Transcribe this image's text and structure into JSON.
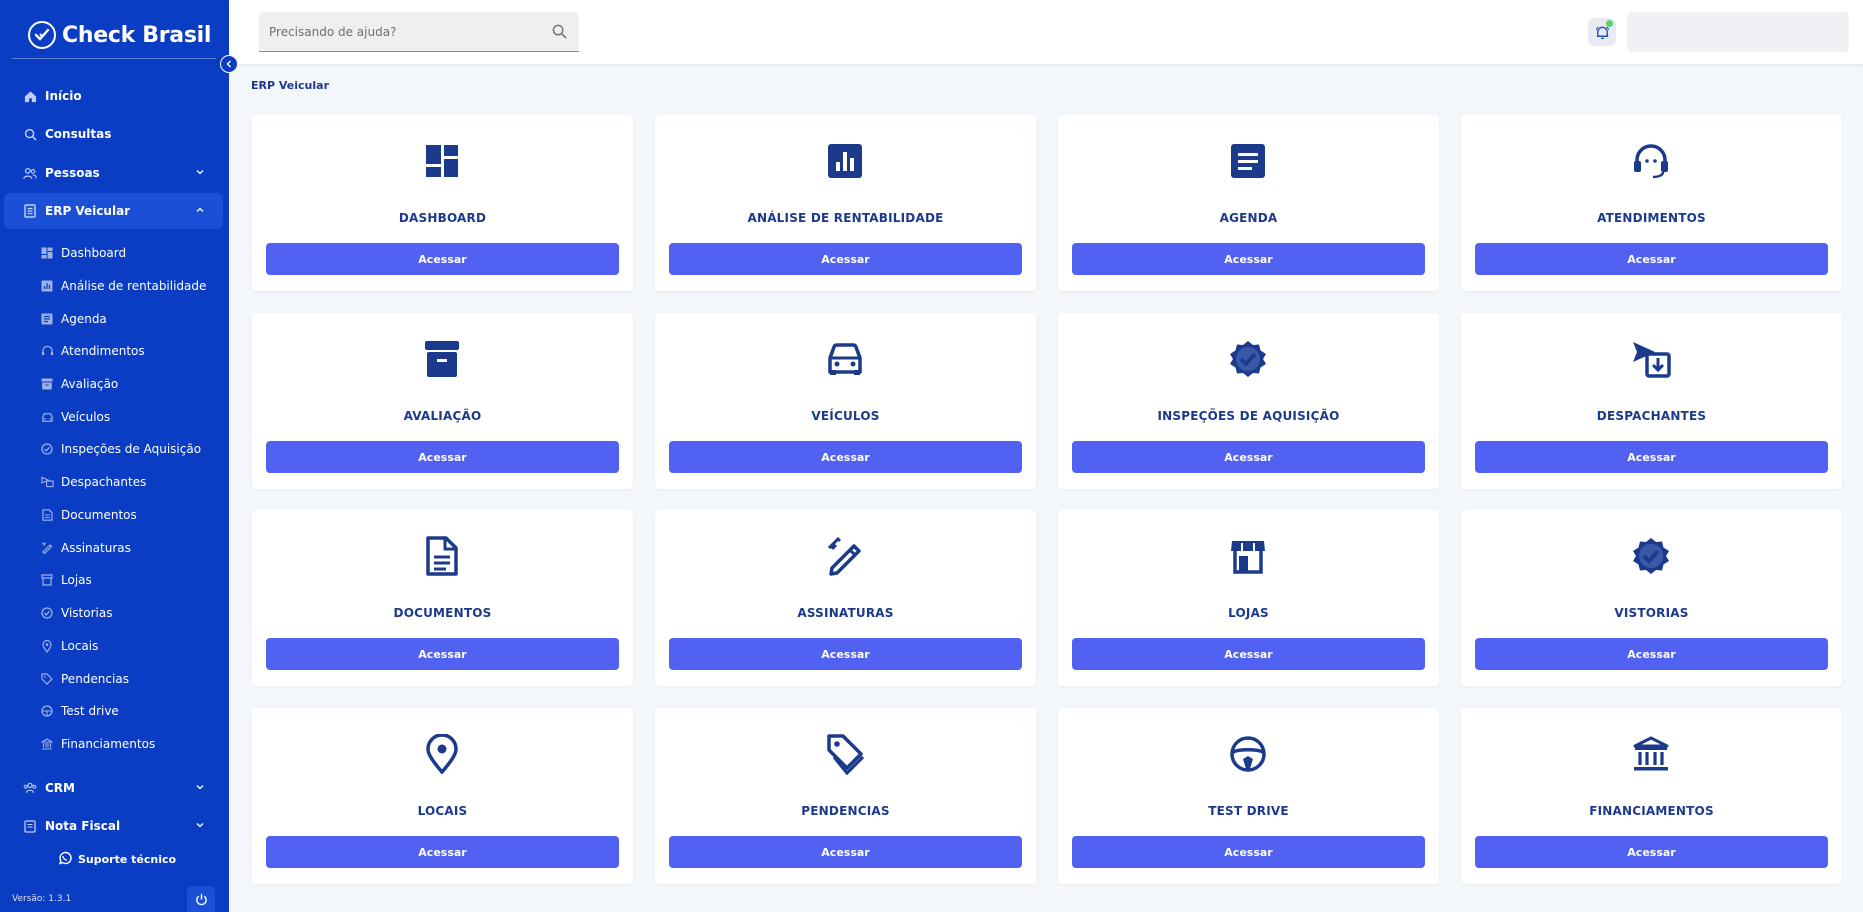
{
  "brand": {
    "name": "Check Brasil"
  },
  "sidebar": {
    "items": [
      {
        "label": "Início",
        "icon": "home-icon"
      },
      {
        "label": "Consultas",
        "icon": "search-icon"
      },
      {
        "label": "Pessoas",
        "icon": "people-icon"
      },
      {
        "label": "ERP Veicular",
        "icon": "erp-icon"
      },
      {
        "label": "CRM",
        "icon": "crm-icon"
      },
      {
        "label": "Nota Fiscal",
        "icon": "invoice-icon"
      }
    ],
    "sub_items": [
      "Dashboard",
      "Análise de rentabilidade",
      "Agenda",
      "Atendimentos",
      "Avaliação",
      "Veículos",
      "Inspeções de Aquisição",
      "Despachantes",
      "Documentos",
      "Assinaturas",
      "Lojas",
      "Vistorias",
      "Locais",
      "Pendencias",
      "Test drive",
      "Financiamentos"
    ],
    "support_label": "Suporte técnico",
    "version": "Versão: 1.3.1"
  },
  "header": {
    "search_placeholder": "Precisando de ajuda?"
  },
  "breadcrumb": "ERP Veicular",
  "cards": [
    {
      "title": "DASHBOARD",
      "button": "Acessar",
      "icon": "dashboard-icon"
    },
    {
      "title": "ANÁLISE DE RENTABILIDADE",
      "button": "Acessar",
      "icon": "bar-chart-icon"
    },
    {
      "title": "AGENDA",
      "button": "Acessar",
      "icon": "agenda-icon"
    },
    {
      "title": "ATENDIMENTOS",
      "button": "Acessar",
      "icon": "headset-icon"
    },
    {
      "title": "AVALIAÇÃO",
      "button": "Acessar",
      "icon": "archive-icon"
    },
    {
      "title": "VEÍCULOS",
      "button": "Acessar",
      "icon": "car-icon"
    },
    {
      "title": "INSPEÇÕES DE AQUISIÇÃO",
      "button": "Acessar",
      "icon": "verified-badge-icon"
    },
    {
      "title": "DESPACHANTES",
      "button": "Acessar",
      "icon": "dispatch-icon"
    },
    {
      "title": "DOCUMENTOS",
      "button": "Acessar",
      "icon": "document-icon"
    },
    {
      "title": "ASSINATURAS",
      "button": "Acessar",
      "icon": "signature-icon"
    },
    {
      "title": "LOJAS",
      "button": "Acessar",
      "icon": "store-icon"
    },
    {
      "title": "VISTORIAS",
      "button": "Acessar",
      "icon": "verified-badge-icon"
    },
    {
      "title": "LOCAIS",
      "button": "Acessar",
      "icon": "location-pin-icon"
    },
    {
      "title": "PENDENCIAS",
      "button": "Acessar",
      "icon": "tag-icon"
    },
    {
      "title": "TEST DRIVE",
      "button": "Acessar",
      "icon": "steering-wheel-icon"
    },
    {
      "title": "FINANCIAMENTOS",
      "button": "Acessar",
      "icon": "bank-icon"
    }
  ],
  "colors": {
    "sidebar_bg": "#0a3dc4",
    "button": "#5161f1",
    "title_text": "#1c3a8c",
    "page_bg": "#f3f6fa"
  }
}
